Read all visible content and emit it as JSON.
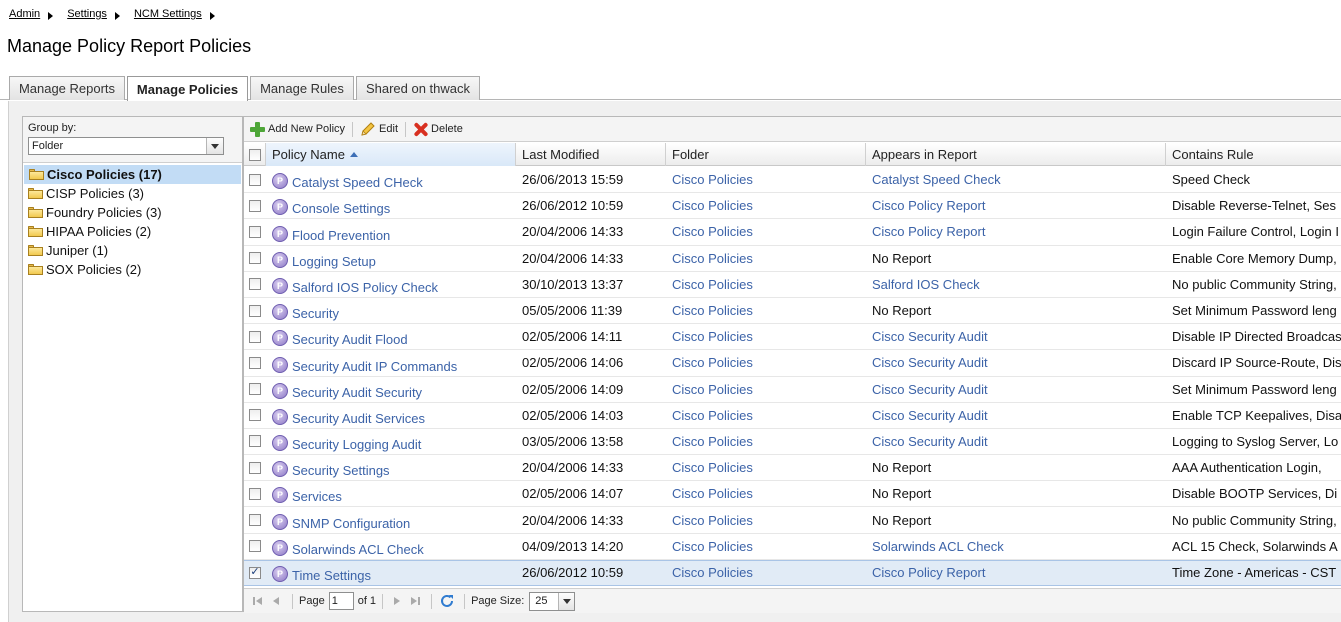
{
  "breadcrumb": [
    "Admin",
    "Settings",
    "NCM Settings"
  ],
  "page_title": "Manage Policy Report Policies",
  "tabs": [
    "Manage Reports",
    "Manage Policies",
    "Manage Rules",
    "Shared on thwack"
  ],
  "active_tab": "Manage Policies",
  "group_by": {
    "label": "Group by:",
    "value": "Folder",
    "items": [
      "Cisco Policies (17)",
      "CISP Policies (3)",
      "Foundry Policies (3)",
      "HIPAA Policies (2)",
      "Juniper (1)",
      "SOX Policies (2)"
    ],
    "selected": "Cisco Policies (17)"
  },
  "toolbar": {
    "add": "Add New Policy",
    "edit": "Edit",
    "delete": "Delete"
  },
  "grid": {
    "columns": [
      "Policy Name",
      "Last Modified",
      "Folder",
      "Appears in Report",
      "Contains Rule"
    ],
    "sorted_column": "Policy Name",
    "sort_direction": "ascending",
    "rows": [
      {
        "name": "Catalyst Speed CHeck",
        "modified": "26/06/2013 15:59",
        "folder": "Cisco Policies",
        "report": "Catalyst Speed Check",
        "report_is_link": true,
        "rule": "Speed Check",
        "checked": false
      },
      {
        "name": "Console Settings",
        "modified": "26/06/2012 10:59",
        "folder": "Cisco Policies",
        "report": "Cisco Policy Report",
        "report_is_link": true,
        "rule": "Disable Reverse-Telnet, Ses",
        "checked": false
      },
      {
        "name": "Flood Prevention",
        "modified": "20/04/2006 14:33",
        "folder": "Cisco Policies",
        "report": "Cisco Policy Report",
        "report_is_link": true,
        "rule": "Login Failure Control, Login I",
        "checked": false
      },
      {
        "name": "Logging Setup",
        "modified": "20/04/2006 14:33",
        "folder": "Cisco Policies",
        "report": "No Report",
        "report_is_link": false,
        "rule": "Enable Core Memory Dump,",
        "checked": false
      },
      {
        "name": "Salford IOS Policy Check",
        "modified": "30/10/2013 13:37",
        "folder": "Cisco Policies",
        "report": "Salford IOS Check",
        "report_is_link": true,
        "rule": "No public Community String,",
        "checked": false
      },
      {
        "name": "Security",
        "modified": "05/05/2006 11:39",
        "folder": "Cisco Policies",
        "report": "No Report",
        "report_is_link": false,
        "rule": "Set Minimum Password leng",
        "checked": false
      },
      {
        "name": "Security Audit Flood",
        "modified": "02/05/2006 14:11",
        "folder": "Cisco Policies",
        "report": "Cisco Security Audit",
        "report_is_link": true,
        "rule": "Disable IP Directed Broadcas",
        "checked": false
      },
      {
        "name": "Security Audit IP Commands",
        "modified": "02/05/2006 14:06",
        "folder": "Cisco Policies",
        "report": "Cisco Security Audit",
        "report_is_link": true,
        "rule": "Discard IP Source-Route, Dis",
        "checked": false
      },
      {
        "name": "Security Audit Security",
        "modified": "02/05/2006 14:09",
        "folder": "Cisco Policies",
        "report": "Cisco Security Audit",
        "report_is_link": true,
        "rule": "Set Minimum Password leng",
        "checked": false
      },
      {
        "name": "Security Audit Services",
        "modified": "02/05/2006 14:03",
        "folder": "Cisco Policies",
        "report": "Cisco Security Audit",
        "report_is_link": true,
        "rule": "Enable TCP Keepalives, Disa",
        "checked": false
      },
      {
        "name": "Security Logging Audit",
        "modified": "03/05/2006 13:58",
        "folder": "Cisco Policies",
        "report": "Cisco Security Audit",
        "report_is_link": true,
        "rule": "Logging to Syslog Server, Lo",
        "checked": false
      },
      {
        "name": "Security Settings",
        "modified": "20/04/2006 14:33",
        "folder": "Cisco Policies",
        "report": "No Report",
        "report_is_link": false,
        "rule": "AAA Authentication Login,",
        "checked": false
      },
      {
        "name": "Services",
        "modified": "02/05/2006 14:07",
        "folder": "Cisco Policies",
        "report": "No Report",
        "report_is_link": false,
        "rule": "Disable BOOTP Services, Di",
        "checked": false
      },
      {
        "name": "SNMP Configuration",
        "modified": "20/04/2006 14:33",
        "folder": "Cisco Policies",
        "report": "No Report",
        "report_is_link": false,
        "rule": "No public Community String,",
        "checked": false
      },
      {
        "name": "Solarwinds ACL Check",
        "modified": "04/09/2013 14:20",
        "folder": "Cisco Policies",
        "report": "Solarwinds ACL Check",
        "report_is_link": true,
        "rule": "ACL 15 Check, Solarwinds A",
        "checked": false
      },
      {
        "name": "Time Settings",
        "modified": "26/06/2012 10:59",
        "folder": "Cisco Policies",
        "report": "Cisco Policy Report",
        "report_is_link": true,
        "rule": "Time Zone - Americas - CST",
        "checked": true
      }
    ]
  },
  "pager": {
    "page_label": "Page",
    "page_value": "1",
    "of_label": "of 1",
    "page_size_label": "Page Size:",
    "page_size_value": "25"
  },
  "colors": {
    "link": "#3c63a8",
    "selected_row": "#e1ebf6",
    "selected_group": "#c2dcf5"
  }
}
